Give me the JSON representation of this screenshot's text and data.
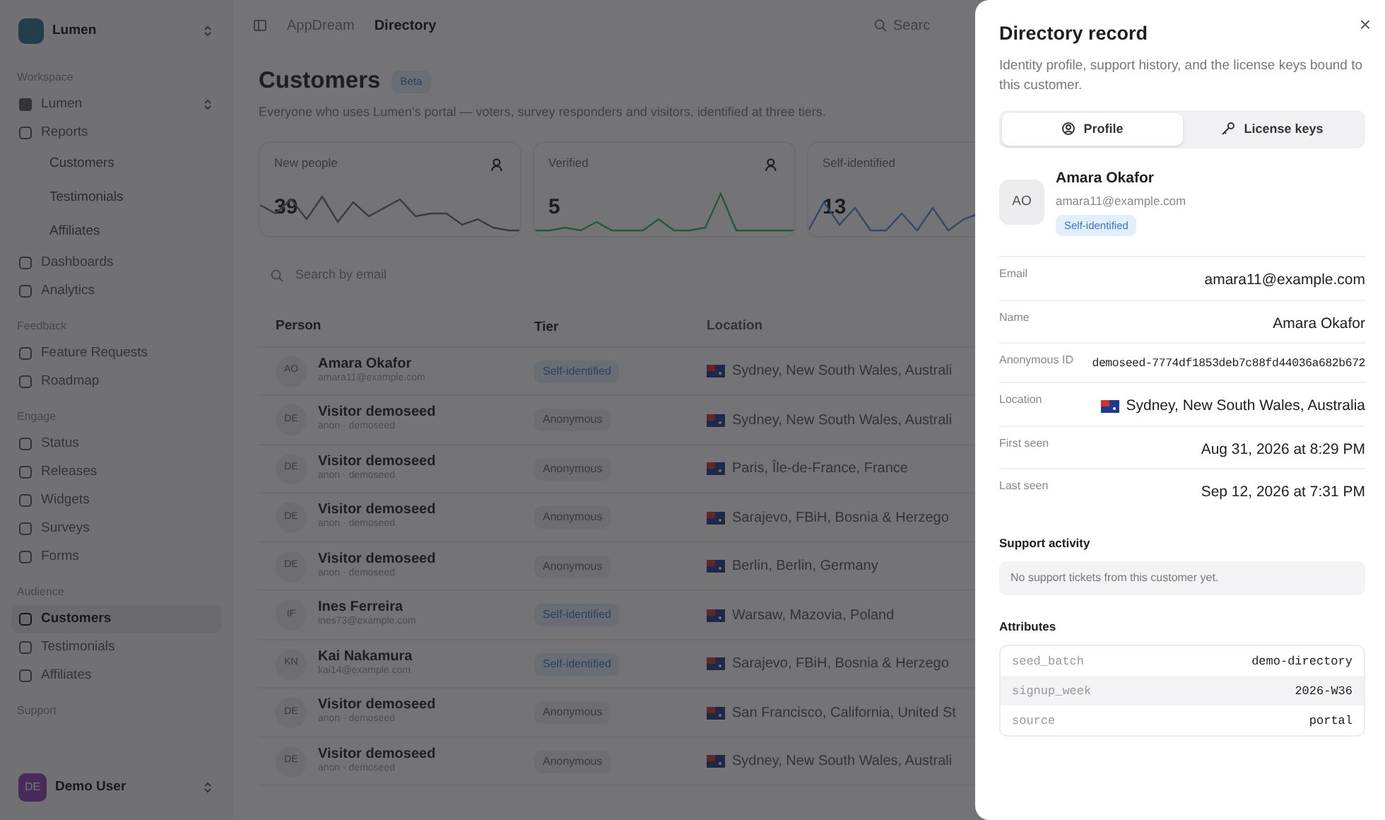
{
  "sidebar": {
    "team": {
      "name": "Lumen"
    },
    "groups": [
      {
        "label": "Workspace",
        "items": [
          {
            "label": "Lumen",
            "kind": "switcher",
            "selected": false
          }
        ]
      },
      {
        "items": [
          {
            "label": "Reports",
            "kind": "item",
            "selected": false,
            "children": [
              {
                "label": "Customers",
                "selected": false
              },
              {
                "label": "Testimonials",
                "selected": false
              },
              {
                "label": "Affiliates",
                "selected": false
              }
            ]
          },
          {
            "label": "Dashboards",
            "kind": "item",
            "selected": false
          },
          {
            "label": "Analytics",
            "kind": "item",
            "selected": false
          }
        ]
      },
      {
        "label": "Feedback",
        "items": [
          {
            "label": "Feature Requests",
            "kind": "item",
            "selected": false
          },
          {
            "label": "Roadmap",
            "kind": "item",
            "selected": false
          }
        ]
      },
      {
        "label": "Engage",
        "items": [
          {
            "label": "Status",
            "kind": "item",
            "selected": false
          },
          {
            "label": "Releases",
            "kind": "item",
            "selected": false
          },
          {
            "label": "Widgets",
            "kind": "item",
            "selected": false
          },
          {
            "label": "Surveys",
            "kind": "item",
            "selected": false
          },
          {
            "label": "Forms",
            "kind": "item",
            "selected": false
          }
        ]
      },
      {
        "label": "Audience",
        "items": [
          {
            "label": "Customers",
            "kind": "item",
            "selected": true
          },
          {
            "label": "Testimonials",
            "kind": "item",
            "selected": false
          },
          {
            "label": "Affiliates",
            "kind": "item",
            "selected": false
          }
        ]
      },
      {
        "label": "Support"
      }
    ],
    "user": {
      "initials": "DE",
      "name": "Demo User"
    }
  },
  "topbar": {
    "breadcrumbs": [
      {
        "label": "AppDream",
        "selected": false
      },
      {
        "label": "Directory",
        "selected": true
      }
    ],
    "search": {
      "placeholder": "Searc"
    }
  },
  "page": {
    "title": "Customers",
    "badge": "Beta",
    "description": "Everyone who uses Lumen's portal — voters, survey responders and visitors, identified at three tiers."
  },
  "stats": [
    {
      "label": "New people",
      "value": "39"
    },
    {
      "label": "Verified",
      "value": "5"
    },
    {
      "label": "Self-identified",
      "value": "13"
    }
  ],
  "table": {
    "search": {
      "placeholder": "Search by email"
    },
    "columns": [
      "Person",
      "Tier",
      "Location"
    ],
    "rows": [
      {
        "initials": "AO",
        "name": "Amara Okafor",
        "sub": "amara11@example.com",
        "tier": "Self-identified",
        "kind": "self",
        "location": "Sydney, New South Wales, Australi"
      },
      {
        "initials": "DE",
        "name": "Visitor demoseed",
        "sub": "anon · demoseed",
        "tier": "Anonymous",
        "kind": "anon",
        "location": "Sydney, New South Wales, Australi"
      },
      {
        "initials": "DE",
        "name": "Visitor demoseed",
        "sub": "anon · demoseed",
        "tier": "Anonymous",
        "kind": "anon",
        "location": "Paris, Île-de-France, France"
      },
      {
        "initials": "DE",
        "name": "Visitor demoseed",
        "sub": "anon · demoseed",
        "tier": "Anonymous",
        "kind": "anon",
        "location": "Sarajevo, FBiH, Bosnia & Herzego"
      },
      {
        "initials": "DE",
        "name": "Visitor demoseed",
        "sub": "anon · demoseed",
        "tier": "Anonymous",
        "kind": "anon",
        "location": "Berlin, Berlin, Germany"
      },
      {
        "initials": "IF",
        "name": "Ines Ferreira",
        "sub": "ines73@example.com",
        "tier": "Self-identified",
        "kind": "self",
        "location": "Warsaw, Mazovia, Poland"
      },
      {
        "initials": "KN",
        "name": "Kai Nakamura",
        "sub": "kai14@example.com",
        "tier": "Self-identified",
        "kind": "self",
        "location": "Sarajevo, FBiH, Bosnia & Herzego"
      },
      {
        "initials": "DE",
        "name": "Visitor demoseed",
        "sub": "anon · demoseed",
        "tier": "Anonymous",
        "kind": "anon",
        "location": "San Francisco, California, United St"
      },
      {
        "initials": "DE",
        "name": "Visitor demoseed",
        "sub": "anon · demoseed",
        "tier": "Anonymous",
        "kind": "anon",
        "location": "Sydney, New South Wales, Australi"
      }
    ]
  },
  "sheet": {
    "title": "Directory record",
    "description": "Identity profile, support history, and the license keys bound to this customer.",
    "close": "×",
    "tabs": [
      {
        "label": "Profile",
        "selected": true
      },
      {
        "label": "License keys",
        "selected": false
      }
    ],
    "profile": {
      "initials": "AO",
      "name": "Amara Okafor",
      "email": "amara11@example.com",
      "badge": "Self-identified"
    },
    "fields": [
      {
        "label": "Email",
        "value": "amara11@example.com",
        "kind": "text"
      },
      {
        "label": "Name",
        "value": "Amara Okafor",
        "kind": "text"
      },
      {
        "label": "Anonymous ID",
        "value": "demoseed-7774df1853deb7c88fd44036a682b672",
        "kind": "mono"
      },
      {
        "label": "Location",
        "value": "Sydney, New South Wales, Australia",
        "kind": "location"
      },
      {
        "label": "First seen",
        "value": "Aug 31, 2026 at 8:29 PM",
        "kind": "text"
      },
      {
        "label": "Last seen",
        "value": "Sep 12, 2026 at 7:31 PM",
        "kind": "text"
      }
    ],
    "support": {
      "heading": "Support activity",
      "empty": "No support tickets from this customer yet."
    },
    "attributes": {
      "heading": "Attributes",
      "rows": [
        {
          "key": "seed_batch",
          "value": "demo-directory"
        },
        {
          "key": "signup_week",
          "value": "2026-W36"
        },
        {
          "key": "source",
          "value": "portal"
        }
      ]
    }
  }
}
